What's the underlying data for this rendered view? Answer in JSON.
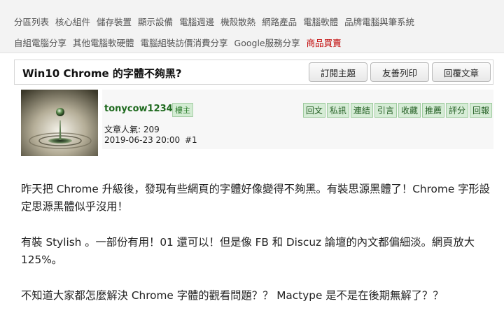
{
  "nav": {
    "row1": [
      "分區列表",
      "核心組件",
      "儲存裝置",
      "顯示設備",
      "電腦週邊",
      "機殼散熱",
      "網路產品",
      "電腦軟體",
      "品牌電腦與筆系統"
    ],
    "row2": [
      "自組電腦分享",
      "其他電腦軟硬體",
      "電腦組裝訪價消費分享",
      "Google服務分享",
      "商品買賣"
    ]
  },
  "thread": {
    "title": "Win10 Chrome 的字體不夠黑?",
    "buttons": [
      "訂閱主題",
      "友善列印",
      "回覆文章"
    ]
  },
  "post": {
    "author": "tonycow1234",
    "role": "樓主",
    "popularity": "文章人氣: 209",
    "date": "2019-06-23 20:00",
    "floor": "#1",
    "actions": [
      "回文",
      "私訊",
      "連結",
      "引言",
      "收藏",
      "推薦",
      "評分",
      "回報"
    ],
    "paragraphs": [
      "昨天把 Chrome 升級後，發現有些網頁的字體好像變得不夠黑。有裝思源黑體了！Chrome 字形設定思源黑體似乎沒用！",
      "有裝 Stylish 。一部份有用！01 還可以！但是像 FB 和 Discuz 論壇的內文都偏細淡。網頁放大 125%。",
      "不知道大家都怎麼解決 Chrome 字體的觀看問題？？ Mactype 是不是在後期無解了？？"
    ]
  },
  "colors": {
    "author": "#1f6a1f",
    "hot_link": "#c00000",
    "action_bg": "#d6ecd6"
  }
}
